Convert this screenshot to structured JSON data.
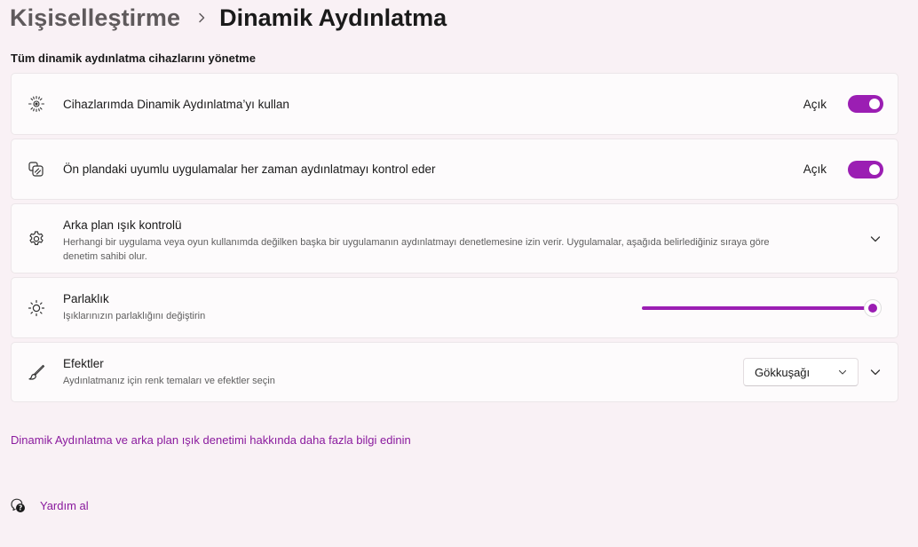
{
  "breadcrumb": {
    "parent": "Kişiselleştirme",
    "current": "Dinamik Aydınlatma"
  },
  "section_title": "Tüm dinamik aydınlatma cihazlarını yönetme",
  "settings": {
    "use_on_devices": {
      "title": "Cihazlarımda Dinamik Aydınlatma’yı kullan",
      "state_label": "Açık",
      "on": true
    },
    "foreground_apps": {
      "title": "Ön plandaki uyumlu uygulamalar her zaman aydınlatmayı kontrol eder",
      "state_label": "Açık",
      "on": true
    },
    "background_control": {
      "title": "Arka plan ışık kontrolü",
      "desc_line1": "Herhangi bir uygulama veya oyun kullanımda değilken başka bir uygulamanın aydınlatmayı denetlemesine izin verir. Uygulamalar, aşağıda belirlediğiniz sıraya göre",
      "desc_line2": "denetim sahibi olur."
    },
    "brightness": {
      "title": "Parlaklık",
      "desc": "Işıklarınızın parlaklığını değiştirin",
      "value_percent": 100
    },
    "effects": {
      "title": "Efektler",
      "desc": "Aydınlatmanız için renk temaları ve efektler seçin",
      "selected": "Gökkuşağı"
    }
  },
  "learn_more_link": "Dinamik Aydınlatma ve arka plan ışık denetimi hakkında daha fazla bilgi edinin",
  "help_link": "Yardım al",
  "colors": {
    "accent": "#9b1eb3",
    "link": "#8a1a9e",
    "background": "#f9f1f5"
  },
  "icons": [
    "chevron-right-icon",
    "lighting-icon",
    "apps-overlap-icon",
    "gear-icon",
    "sun-icon",
    "brush-icon",
    "chevron-down-icon",
    "help-icon"
  ]
}
